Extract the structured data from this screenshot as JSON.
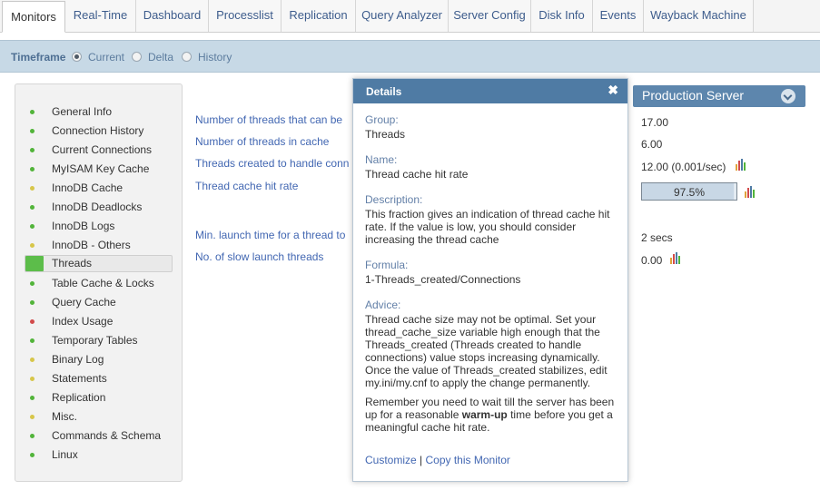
{
  "tabs": [
    {
      "label": "Monitors",
      "active": true
    },
    {
      "label": "Real-Time"
    },
    {
      "label": "Dashboard"
    },
    {
      "label": "Processlist"
    },
    {
      "label": "Replication"
    },
    {
      "label": "Query Analyzer"
    },
    {
      "label": "Server Config"
    },
    {
      "label": "Disk Info"
    },
    {
      "label": "Events"
    },
    {
      "label": "Wayback Machine"
    }
  ],
  "timeframe": {
    "label": "Timeframe",
    "options": [
      {
        "label": "Current",
        "selected": true
      },
      {
        "label": "Delta",
        "selected": false
      },
      {
        "label": "History",
        "selected": false
      }
    ]
  },
  "menu": [
    {
      "label": "General Info",
      "status": "green"
    },
    {
      "label": "Connection History",
      "status": "green"
    },
    {
      "label": "Current Connections",
      "status": "green"
    },
    {
      "label": "MyISAM Key Cache",
      "status": "green"
    },
    {
      "label": "InnoDB Cache",
      "status": "yellow"
    },
    {
      "label": "InnoDB Deadlocks",
      "status": "green"
    },
    {
      "label": "InnoDB Logs",
      "status": "green"
    },
    {
      "label": "InnoDB - Others",
      "status": "yellow"
    },
    {
      "label": "Threads",
      "status": "green",
      "selected": true
    },
    {
      "label": "Table Cache & Locks",
      "status": "green"
    },
    {
      "label": "Query Cache",
      "status": "green"
    },
    {
      "label": "Index Usage",
      "status": "red"
    },
    {
      "label": "Temporary Tables",
      "status": "green"
    },
    {
      "label": "Binary Log",
      "status": "yellow"
    },
    {
      "label": "Statements",
      "status": "yellow"
    },
    {
      "label": "Replication",
      "status": "green"
    },
    {
      "label": "Misc.",
      "status": "yellow"
    },
    {
      "label": "Commands & Schema",
      "status": "green"
    },
    {
      "label": "Linux",
      "status": "green"
    }
  ],
  "status_colors": {
    "green": "#52b43a",
    "yellow": "#d7c64a",
    "red": "#d24b4b"
  },
  "metrics": [
    {
      "label": "Number of threads that can be",
      "value": "17.00"
    },
    {
      "label": "Number of threads in cache",
      "value": "6.00"
    },
    {
      "label": "Threads created to handle conn",
      "value": "12.00 (0.001/sec)",
      "chart_icon": true
    },
    {
      "label": "Thread cache hit rate",
      "value": "97.5%",
      "gauge": 0.975,
      "chart_icon": true
    },
    {
      "label": "Min. launch time for a thread to",
      "value": "2 secs"
    },
    {
      "label": "No. of slow launch threads",
      "value": "0.00",
      "chart_icon": true
    }
  ],
  "server_panel": {
    "title": "Production Server",
    "icon": "chevron-down-icon"
  },
  "details": {
    "title": "Details",
    "close_icon": "close-icon",
    "group_key": "Group:",
    "group": "Threads",
    "name_key": "Name:",
    "name": "Thread cache hit rate",
    "description_key": "Description:",
    "description": "This fraction gives an indication of thread cache hit rate. If the value is low, you should consider increasing the thread cache",
    "formula_key": "Formula:",
    "formula": "1-Threads_created/Connections",
    "advice_key": "Advice:",
    "advice": "Thread cache size may not be optimal. Set your thread_cache_size variable high enough that the Threads_created (Threads created to handle connections) value stops increasing dynamically. Once the value of Threads_created stabilizes, edit my.ini/my.cnf to apply the change permanently.",
    "advice2_pre": "Remember you need to wait till the server has been up for a reasonable ",
    "advice2_bold": "warm-up",
    "advice2_post": " time before you get a meaningful cache hit rate.",
    "customize": "Customize",
    "separator": "|",
    "copy": "Copy this Monitor"
  }
}
